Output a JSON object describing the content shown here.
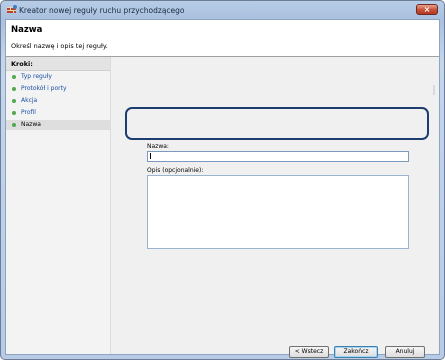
{
  "window": {
    "title": "Kreator nowej reguły ruchu przychodzącego",
    "close_label": "×"
  },
  "header": {
    "title": "Nazwa",
    "subtitle": "Określ nazwę i opis tej reguły."
  },
  "steps": {
    "heading": "Kroki:",
    "items": [
      {
        "label": "Typ reguły",
        "active": false
      },
      {
        "label": "Protokół i porty",
        "active": false
      },
      {
        "label": "Akcja",
        "active": false
      },
      {
        "label": "Profil",
        "active": false
      },
      {
        "label": "Nazwa",
        "active": true
      }
    ]
  },
  "form": {
    "name_label": "Nazwa:",
    "name_value": "",
    "description_label": "Opis (opcjonalnie):",
    "description_value": ""
  },
  "buttons": {
    "back": "< Wstecz",
    "finish": "Zakończ",
    "cancel": "Anuluj"
  },
  "colors": {
    "step_dot": "#53a753",
    "step_link": "#1a4fa0",
    "highlight": "#1d3d6e"
  }
}
